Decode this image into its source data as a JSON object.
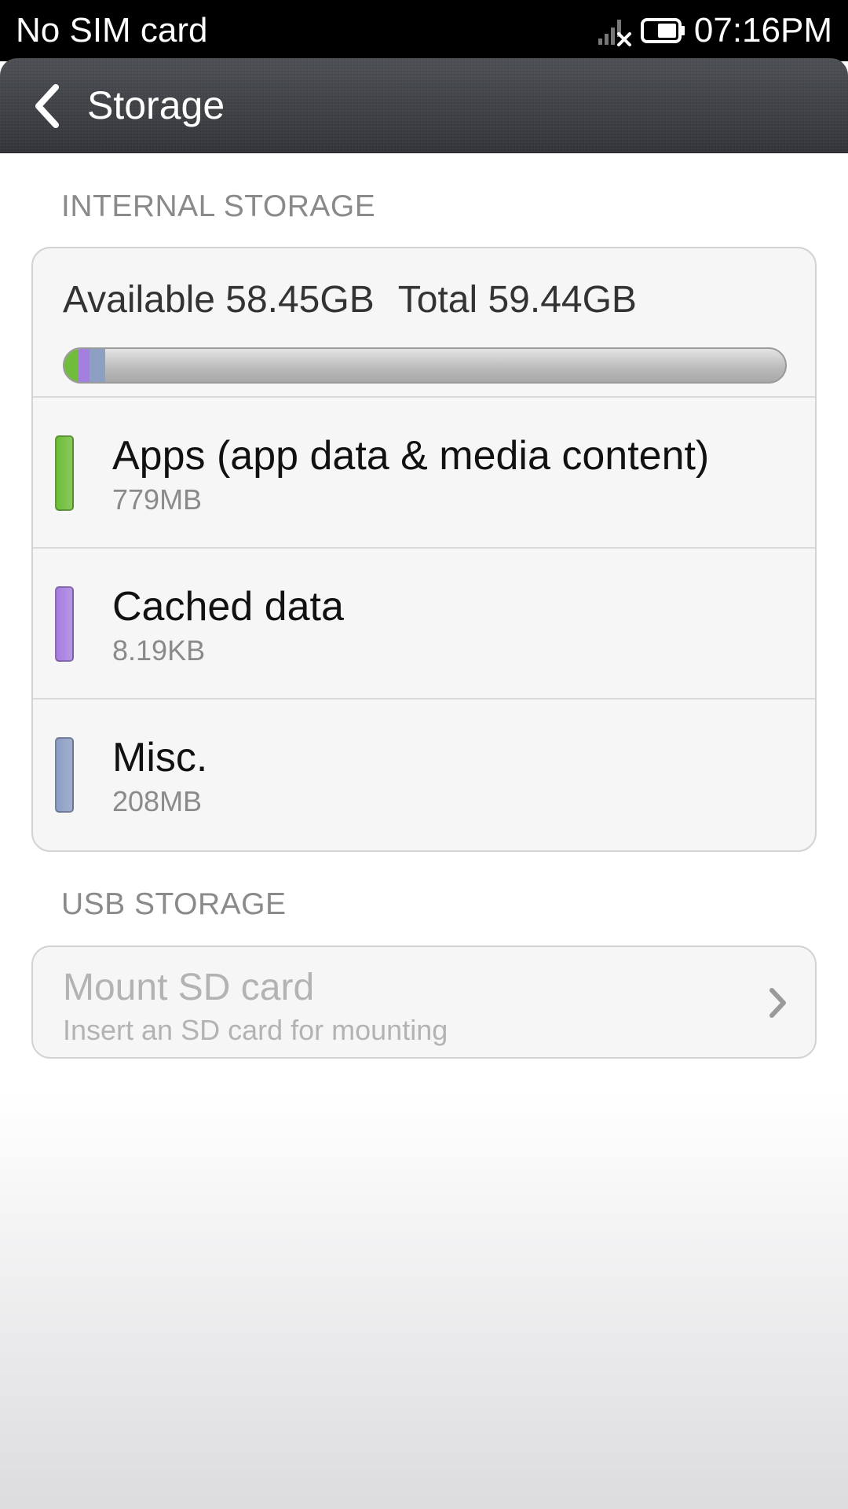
{
  "status_bar": {
    "carrier": "No SIM card",
    "time": "07:16PM",
    "signal_icon": "signal-no-sim-icon",
    "battery_icon": "battery-icon"
  },
  "action_bar": {
    "back_icon": "chevron-left-icon",
    "title": "Storage"
  },
  "internal_storage": {
    "header": "INTERNAL STORAGE",
    "available": "Available 58.45GB",
    "total": "Total 59.44GB",
    "usage_bar": [
      {
        "name": "apps",
        "fraction": 0.0128,
        "color": "#6fbd3a"
      },
      {
        "name": "cached",
        "fraction": 0.0001,
        "color": "#a57fe0"
      },
      {
        "name": "misc",
        "fraction": 0.0034,
        "color": "#8e9fc4"
      }
    ],
    "items": [
      {
        "label": "Apps (app data & media content)",
        "size": "779MB",
        "color": "#6dbd36"
      },
      {
        "label": "Cached data",
        "size": "8.19KB",
        "color": "#a67ddf"
      },
      {
        "label": "Misc.",
        "size": "208MB",
        "color": "#8c9dc4"
      }
    ]
  },
  "usb_storage": {
    "header": "USB STORAGE",
    "mount_title": "Mount SD card",
    "mount_subtitle": "Insert an SD card for mounting",
    "chevron_icon": "chevron-right-icon"
  }
}
